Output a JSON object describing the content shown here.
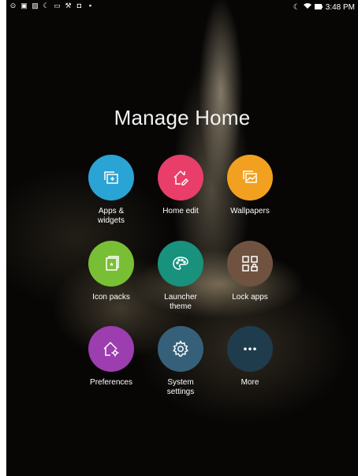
{
  "status_bar": {
    "time": "3:48 PM",
    "left_icons": [
      "location-icon",
      "notification-icon",
      "photo-icon",
      "moon-icon",
      "notification-icon",
      "tool-icon",
      "camera-icon",
      "clipboard-icon"
    ],
    "right_icons": [
      "moon-icon",
      "wifi-icon",
      "battery-icon"
    ]
  },
  "title": "Manage Home",
  "items": [
    {
      "label": "Apps &\nwidgets",
      "color": "#2aa4d5",
      "icon": "apps-widgets-icon"
    },
    {
      "label": "Home edit",
      "color": "#e83e69",
      "icon": "home-edit-icon"
    },
    {
      "label": "Wallpapers",
      "color": "#f1a11f",
      "icon": "wallpapers-icon"
    },
    {
      "label": "Icon packs",
      "color": "#79bf35",
      "icon": "icon-packs-icon"
    },
    {
      "label": "Launcher\ntheme",
      "color": "#18917d",
      "icon": "palette-icon"
    },
    {
      "label": "Lock apps",
      "color": "#6f5340",
      "icon": "lock-apps-icon"
    },
    {
      "label": "Preferences",
      "color": "#9c3db0",
      "icon": "preferences-icon"
    },
    {
      "label": "System\nsettings",
      "color": "#36607a",
      "icon": "gear-icon"
    },
    {
      "label": "More",
      "color": "#1f3c4d",
      "icon": "more-icon"
    }
  ]
}
